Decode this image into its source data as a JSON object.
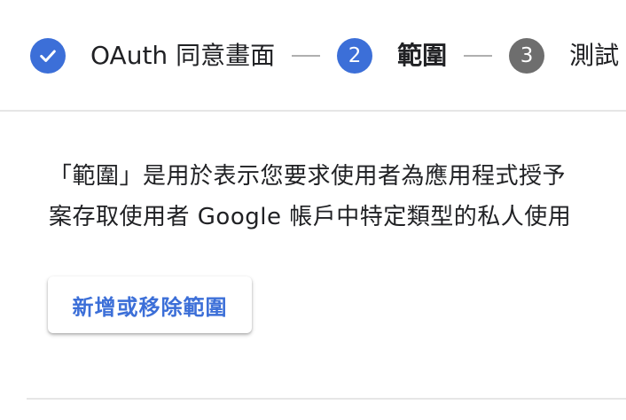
{
  "stepper": {
    "steps": [
      {
        "number": "✓",
        "label": "OAuth 同意畫面",
        "state": "done"
      },
      {
        "number": "2",
        "label": "範圍",
        "state": "active"
      },
      {
        "number": "3",
        "label": "測試",
        "state": "todo"
      }
    ]
  },
  "scopes": {
    "description_line1": "「範圍」是用於表示您要求使用者為應用程式授予",
    "description_line2": "案存取使用者 Google 帳戶中特定類型的私人使用",
    "add_remove_button": "新增或移除範圍"
  },
  "colors": {
    "accent": "#3c6fd8",
    "inactive": "#6e6e6e",
    "divider": "#e6e6e6"
  }
}
